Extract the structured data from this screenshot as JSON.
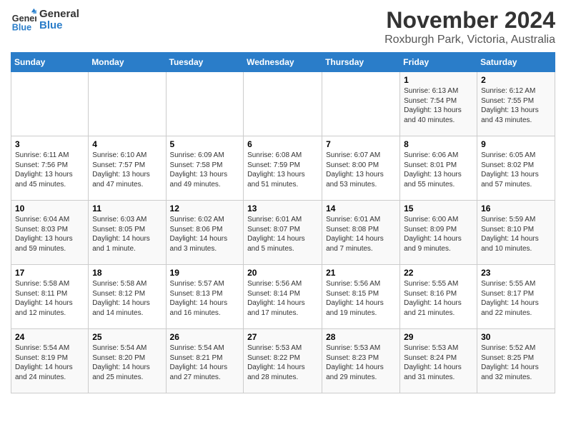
{
  "logo": {
    "line1": "General",
    "line2": "Blue"
  },
  "title": "November 2024",
  "subtitle": "Roxburgh Park, Victoria, Australia",
  "days_of_week": [
    "Sunday",
    "Monday",
    "Tuesday",
    "Wednesday",
    "Thursday",
    "Friday",
    "Saturday"
  ],
  "weeks": [
    [
      {
        "day": "",
        "info": ""
      },
      {
        "day": "",
        "info": ""
      },
      {
        "day": "",
        "info": ""
      },
      {
        "day": "",
        "info": ""
      },
      {
        "day": "",
        "info": ""
      },
      {
        "day": "1",
        "info": "Sunrise: 6:13 AM\nSunset: 7:54 PM\nDaylight: 13 hours\nand 40 minutes."
      },
      {
        "day": "2",
        "info": "Sunrise: 6:12 AM\nSunset: 7:55 PM\nDaylight: 13 hours\nand 43 minutes."
      }
    ],
    [
      {
        "day": "3",
        "info": "Sunrise: 6:11 AM\nSunset: 7:56 PM\nDaylight: 13 hours\nand 45 minutes."
      },
      {
        "day": "4",
        "info": "Sunrise: 6:10 AM\nSunset: 7:57 PM\nDaylight: 13 hours\nand 47 minutes."
      },
      {
        "day": "5",
        "info": "Sunrise: 6:09 AM\nSunset: 7:58 PM\nDaylight: 13 hours\nand 49 minutes."
      },
      {
        "day": "6",
        "info": "Sunrise: 6:08 AM\nSunset: 7:59 PM\nDaylight: 13 hours\nand 51 minutes."
      },
      {
        "day": "7",
        "info": "Sunrise: 6:07 AM\nSunset: 8:00 PM\nDaylight: 13 hours\nand 53 minutes."
      },
      {
        "day": "8",
        "info": "Sunrise: 6:06 AM\nSunset: 8:01 PM\nDaylight: 13 hours\nand 55 minutes."
      },
      {
        "day": "9",
        "info": "Sunrise: 6:05 AM\nSunset: 8:02 PM\nDaylight: 13 hours\nand 57 minutes."
      }
    ],
    [
      {
        "day": "10",
        "info": "Sunrise: 6:04 AM\nSunset: 8:03 PM\nDaylight: 13 hours\nand 59 minutes."
      },
      {
        "day": "11",
        "info": "Sunrise: 6:03 AM\nSunset: 8:05 PM\nDaylight: 14 hours\nand 1 minute."
      },
      {
        "day": "12",
        "info": "Sunrise: 6:02 AM\nSunset: 8:06 PM\nDaylight: 14 hours\nand 3 minutes."
      },
      {
        "day": "13",
        "info": "Sunrise: 6:01 AM\nSunset: 8:07 PM\nDaylight: 14 hours\nand 5 minutes."
      },
      {
        "day": "14",
        "info": "Sunrise: 6:01 AM\nSunset: 8:08 PM\nDaylight: 14 hours\nand 7 minutes."
      },
      {
        "day": "15",
        "info": "Sunrise: 6:00 AM\nSunset: 8:09 PM\nDaylight: 14 hours\nand 9 minutes."
      },
      {
        "day": "16",
        "info": "Sunrise: 5:59 AM\nSunset: 8:10 PM\nDaylight: 14 hours\nand 10 minutes."
      }
    ],
    [
      {
        "day": "17",
        "info": "Sunrise: 5:58 AM\nSunset: 8:11 PM\nDaylight: 14 hours\nand 12 minutes."
      },
      {
        "day": "18",
        "info": "Sunrise: 5:58 AM\nSunset: 8:12 PM\nDaylight: 14 hours\nand 14 minutes."
      },
      {
        "day": "19",
        "info": "Sunrise: 5:57 AM\nSunset: 8:13 PM\nDaylight: 14 hours\nand 16 minutes."
      },
      {
        "day": "20",
        "info": "Sunrise: 5:56 AM\nSunset: 8:14 PM\nDaylight: 14 hours\nand 17 minutes."
      },
      {
        "day": "21",
        "info": "Sunrise: 5:56 AM\nSunset: 8:15 PM\nDaylight: 14 hours\nand 19 minutes."
      },
      {
        "day": "22",
        "info": "Sunrise: 5:55 AM\nSunset: 8:16 PM\nDaylight: 14 hours\nand 21 minutes."
      },
      {
        "day": "23",
        "info": "Sunrise: 5:55 AM\nSunset: 8:17 PM\nDaylight: 14 hours\nand 22 minutes."
      }
    ],
    [
      {
        "day": "24",
        "info": "Sunrise: 5:54 AM\nSunset: 8:19 PM\nDaylight: 14 hours\nand 24 minutes."
      },
      {
        "day": "25",
        "info": "Sunrise: 5:54 AM\nSunset: 8:20 PM\nDaylight: 14 hours\nand 25 minutes."
      },
      {
        "day": "26",
        "info": "Sunrise: 5:54 AM\nSunset: 8:21 PM\nDaylight: 14 hours\nand 27 minutes."
      },
      {
        "day": "27",
        "info": "Sunrise: 5:53 AM\nSunset: 8:22 PM\nDaylight: 14 hours\nand 28 minutes."
      },
      {
        "day": "28",
        "info": "Sunrise: 5:53 AM\nSunset: 8:23 PM\nDaylight: 14 hours\nand 29 minutes."
      },
      {
        "day": "29",
        "info": "Sunrise: 5:53 AM\nSunset: 8:24 PM\nDaylight: 14 hours\nand 31 minutes."
      },
      {
        "day": "30",
        "info": "Sunrise: 5:52 AM\nSunset: 8:25 PM\nDaylight: 14 hours\nand 32 minutes."
      }
    ]
  ]
}
